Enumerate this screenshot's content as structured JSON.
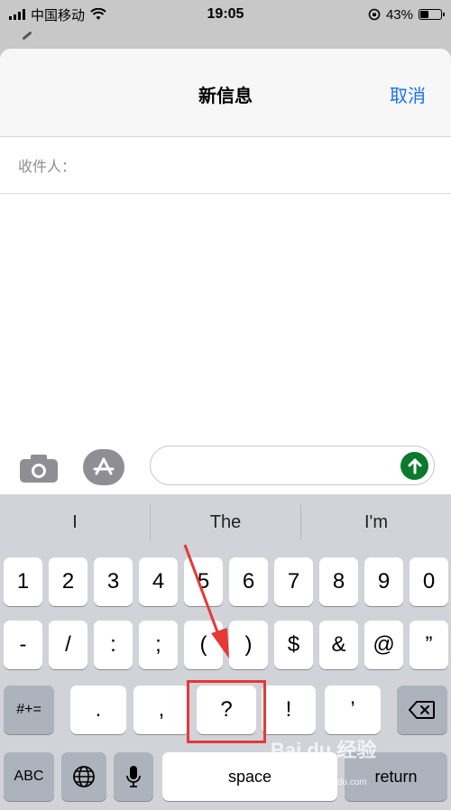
{
  "status_bar": {
    "carrier": "中国移动",
    "time": "19:05",
    "battery": "43%",
    "battery_level": 0.43,
    "icons": [
      "signal-icon",
      "wifi-icon",
      "orientation-lock-icon",
      "battery-icon"
    ]
  },
  "nav": {
    "title": "新信息",
    "cancel_label": "取消"
  },
  "recipient": {
    "label": "收件人：",
    "value": ""
  },
  "compose": {
    "message_value": "",
    "icons": [
      "camera-icon",
      "app-store-icon",
      "send-arrow-icon"
    ]
  },
  "keyboard": {
    "predictions": [
      "I",
      "The",
      "I'm"
    ],
    "row1": [
      "1",
      "2",
      "3",
      "4",
      "5",
      "6",
      "7",
      "8",
      "9",
      "0"
    ],
    "row2": [
      "-",
      "/",
      ":",
      ";",
      "(",
      ")",
      "$",
      "&",
      "@",
      "”"
    ],
    "row3": {
      "symbols_label": "#+=",
      "keys": [
        ".",
        ",",
        "?",
        "!",
        "’"
      ],
      "delete_icon": "delete-backspace-icon"
    },
    "row4": {
      "abc_label": "ABC",
      "globe_icon": "globe-icon",
      "mic_icon": "microphone-icon",
      "space_label": "space",
      "return_label": "return"
    }
  },
  "watermark": {
    "brand": "Bai du 经验",
    "url": "jingyan.baidu.com"
  },
  "colors": {
    "accent": "#1a73e8",
    "send": "#0b7a2e",
    "highlight": "#e53935",
    "keyboard_bg": "#d1d3d9"
  }
}
